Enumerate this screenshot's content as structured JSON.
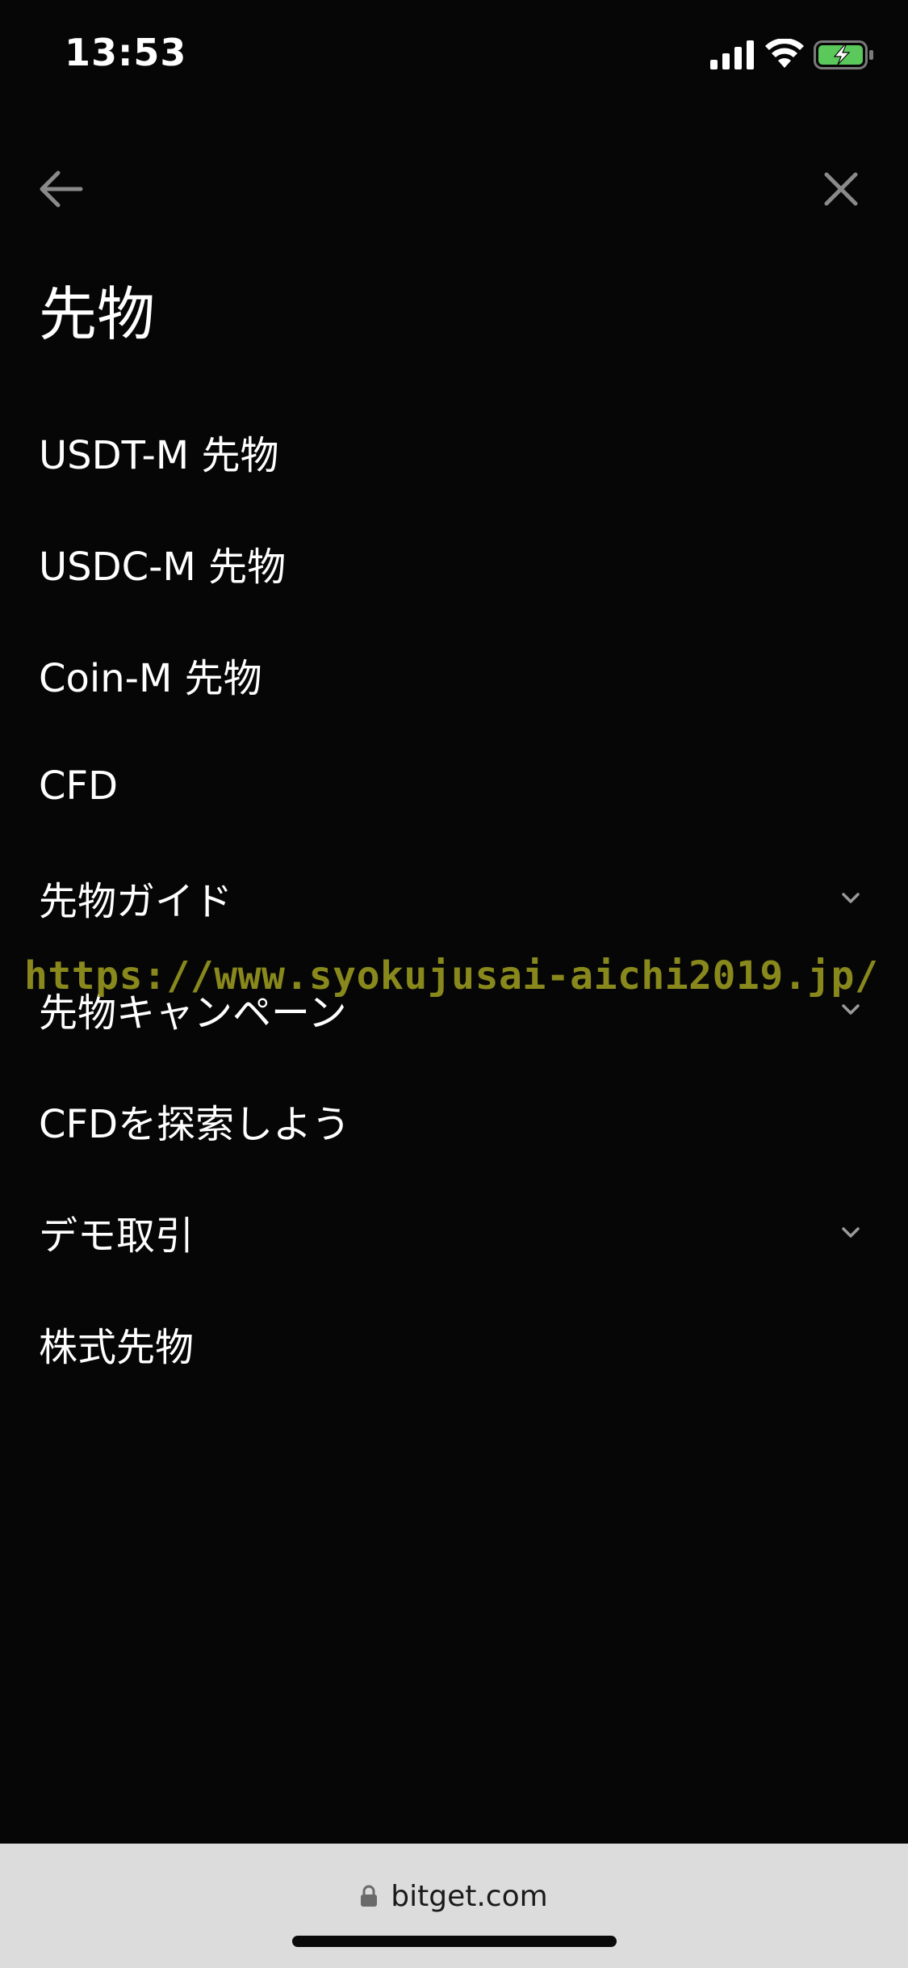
{
  "status_bar": {
    "time": "13:53"
  },
  "nav": {
    "back_icon": "arrow-left-icon",
    "close_icon": "close-icon"
  },
  "page": {
    "title": "先物"
  },
  "menu": {
    "items": [
      {
        "label": "USDT-M 先物",
        "expandable": false
      },
      {
        "label": "USDC-M 先物",
        "expandable": false
      },
      {
        "label": "Coin-M 先物",
        "expandable": false
      },
      {
        "label": "CFD",
        "expandable": false
      },
      {
        "label": "先物ガイド",
        "expandable": true
      },
      {
        "label": "先物キャンペーン",
        "expandable": true
      },
      {
        "label": "CFDを探索しよう",
        "expandable": false
      },
      {
        "label": "デモ取引",
        "expandable": true
      },
      {
        "label": "株式先物",
        "expandable": false
      }
    ]
  },
  "watermark": {
    "text": "https://www.syokujusai-aichi2019.jp/"
  },
  "browser": {
    "address": "bitget.com"
  },
  "colors": {
    "background": "#060606",
    "text": "#ffffff",
    "icon_gray": "#8a8a8a",
    "battery_green": "#5ac85a",
    "watermark": "#8f8f1e",
    "address_bar": "#dcdcdc"
  }
}
